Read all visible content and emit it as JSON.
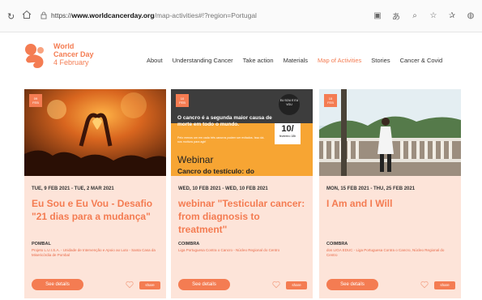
{
  "browser": {
    "url_protocol": "https://",
    "url_domain": "www.worldcancerday.org",
    "url_path": "/map-activities#!?region=Portugal",
    "icons": [
      "reader-icon",
      "translate-icon",
      "zoom-icon",
      "favorite-add-icon",
      "favorites-icon",
      "profile-icon"
    ]
  },
  "site": {
    "logo_line1": "World",
    "logo_line2": "Cancer Day",
    "logo_line3": "4 February",
    "brand_color": "#f47c52",
    "nav": [
      {
        "label": "About",
        "active": false
      },
      {
        "label": "Understanding Cancer",
        "active": false
      },
      {
        "label": "Take action",
        "active": false
      },
      {
        "label": "Materials",
        "active": false
      },
      {
        "label": "Map of Activities",
        "active": true
      },
      {
        "label": "Stories",
        "active": false
      },
      {
        "label": "Cancer & Covid",
        "active": false
      }
    ]
  },
  "cards": [
    {
      "badge_day": "09",
      "badge_month": "FEB",
      "date": "TUE, 9 FEB 2021 - TUE, 2 MAR 2021",
      "title": "Eu Sou e Eu Vou - Desafio \"21 dias para a mudança\"",
      "place": "POMBAL",
      "org": "Projeto L.U.I.S.A. - Unidade de Intervenção e Apoio ao Luto - Santa Casa da Misericórdia de Pombal",
      "details_label": "See details",
      "share_label": "share"
    },
    {
      "badge_day": "10",
      "badge_month": "FEB",
      "date": "WED, 10 FEB 2021 - WED, 10 FEB 2021",
      "title": "webinar \"Testicular cancer: from diagnosis to treatment\"",
      "place": "COIMBRA",
      "org": "Liga Portuguesa Contra o Cancro - Núcleo Regional do Centro",
      "details_label": "See details",
      "share_label": "share",
      "image_text": "O cancro é a segunda maior causa de morte em todo o mundo.",
      "image_sub": "Pelo menos um em cada três cancros podem ser evitados. Isso dá-nos motivos para agir!",
      "image_date_big": "10/",
      "image_date_small": "fevereiro 18h",
      "image_seal": "EU SOU E EU VOU",
      "image_webinar": "Webinar",
      "image_webinar2": "Cancro do testículo: do"
    },
    {
      "badge_day": "15",
      "badge_month": "FEB",
      "date": "MON, 15 FEB 2021 - THU, 25 FEB 2021",
      "title": "I Am and I Will",
      "place": "COIMBRA",
      "org": "dos LIGA EDUC - Liga Portuguesa Contra o Cancro, Núcleo Regional do Centro",
      "details_label": "See details",
      "share_label": "share"
    }
  ]
}
